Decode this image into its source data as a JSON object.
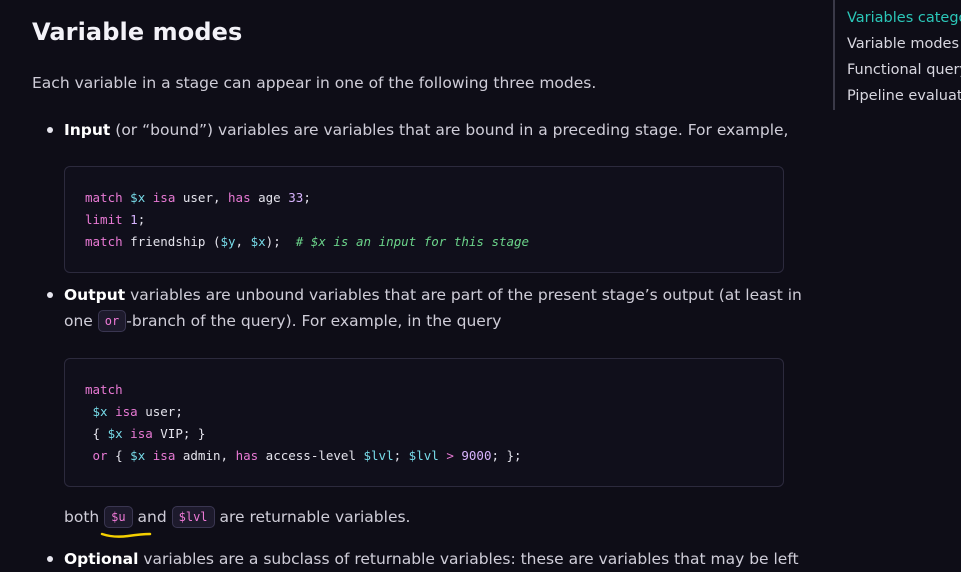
{
  "heading": "Variable modes",
  "intro": "Each variable in a stage can appear in one of the following three modes.",
  "input_item": {
    "term": "Input",
    "text": " (or “bound”) variables are variables that are bound in a preceding stage. For example,"
  },
  "code1": {
    "lines": [
      [
        {
          "t": "match",
          "c": "kw"
        },
        {
          "t": " ",
          "c": "plain"
        },
        {
          "t": "$x",
          "c": "var"
        },
        {
          "t": " ",
          "c": "plain"
        },
        {
          "t": "isa",
          "c": "kw"
        },
        {
          "t": " user, ",
          "c": "plain"
        },
        {
          "t": "has",
          "c": "kw"
        },
        {
          "t": " age ",
          "c": "plain"
        },
        {
          "t": "33",
          "c": "num"
        },
        {
          "t": ";",
          "c": "plain"
        }
      ],
      [
        {
          "t": "limit",
          "c": "kw"
        },
        {
          "t": " ",
          "c": "plain"
        },
        {
          "t": "1",
          "c": "num"
        },
        {
          "t": ";",
          "c": "plain"
        }
      ],
      [
        {
          "t": "match",
          "c": "kw"
        },
        {
          "t": " friendship (",
          "c": "plain"
        },
        {
          "t": "$y",
          "c": "var"
        },
        {
          "t": ", ",
          "c": "plain"
        },
        {
          "t": "$x",
          "c": "var"
        },
        {
          "t": ");  ",
          "c": "plain"
        },
        {
          "t": "# $x is an input for this stage",
          "c": "cmt"
        }
      ]
    ]
  },
  "output_item": {
    "term": "Output",
    "text_line1": " variables are unbound variables that are part of the present stage’s output (at least in",
    "text_before_code": "one ",
    "inline_code": "or",
    "text_after_code": "-branch of the query). For example, in the query"
  },
  "code2": {
    "lines": [
      [
        {
          "t": "match",
          "c": "kw"
        }
      ],
      [
        {
          "t": " ",
          "c": "plain"
        },
        {
          "t": "$x",
          "c": "var"
        },
        {
          "t": " ",
          "c": "plain"
        },
        {
          "t": "isa",
          "c": "kw"
        },
        {
          "t": " user;",
          "c": "plain"
        }
      ],
      [
        {
          "t": " { ",
          "c": "plain"
        },
        {
          "t": "$x",
          "c": "var"
        },
        {
          "t": " ",
          "c": "plain"
        },
        {
          "t": "isa",
          "c": "kw"
        },
        {
          "t": " VIP; }",
          "c": "plain"
        }
      ],
      [
        {
          "t": " ",
          "c": "plain"
        },
        {
          "t": "or",
          "c": "kw"
        },
        {
          "t": " { ",
          "c": "plain"
        },
        {
          "t": "$x",
          "c": "var"
        },
        {
          "t": " ",
          "c": "plain"
        },
        {
          "t": "isa",
          "c": "kw"
        },
        {
          "t": " admin, ",
          "c": "plain"
        },
        {
          "t": "has",
          "c": "kw"
        },
        {
          "t": " access-level ",
          "c": "plain"
        },
        {
          "t": "$lvl",
          "c": "var"
        },
        {
          "t": "; ",
          "c": "plain"
        },
        {
          "t": "$lvl",
          "c": "var"
        },
        {
          "t": " ",
          "c": "plain"
        },
        {
          "t": ">",
          "c": "kw"
        },
        {
          "t": " ",
          "c": "plain"
        },
        {
          "t": "9000",
          "c": "num"
        },
        {
          "t": "; };",
          "c": "plain"
        }
      ]
    ]
  },
  "after_code2": {
    "word_both": "both ",
    "code_u": "$u",
    "word_and": " and ",
    "code_lvl": "$lvl",
    "rest": " are returnable variables."
  },
  "optional_item": {
    "term": "Optional",
    "text": " variables are a subclass of returnable variables: these are variables that may be left"
  },
  "toc": {
    "items": [
      {
        "label": "Variables categor",
        "active": true
      },
      {
        "label": "Variable modes",
        "active": false
      },
      {
        "label": "Functional query",
        "active": false
      },
      {
        "label": "Pipeline evaluatio",
        "active": false
      }
    ]
  },
  "colors": {
    "background": "#0e0d17",
    "accent": "#2bc6b8",
    "keyword": "#e879d4",
    "variable": "#77dbe8",
    "comment": "#6bd38a",
    "underline_annotation": "#f5d000"
  }
}
